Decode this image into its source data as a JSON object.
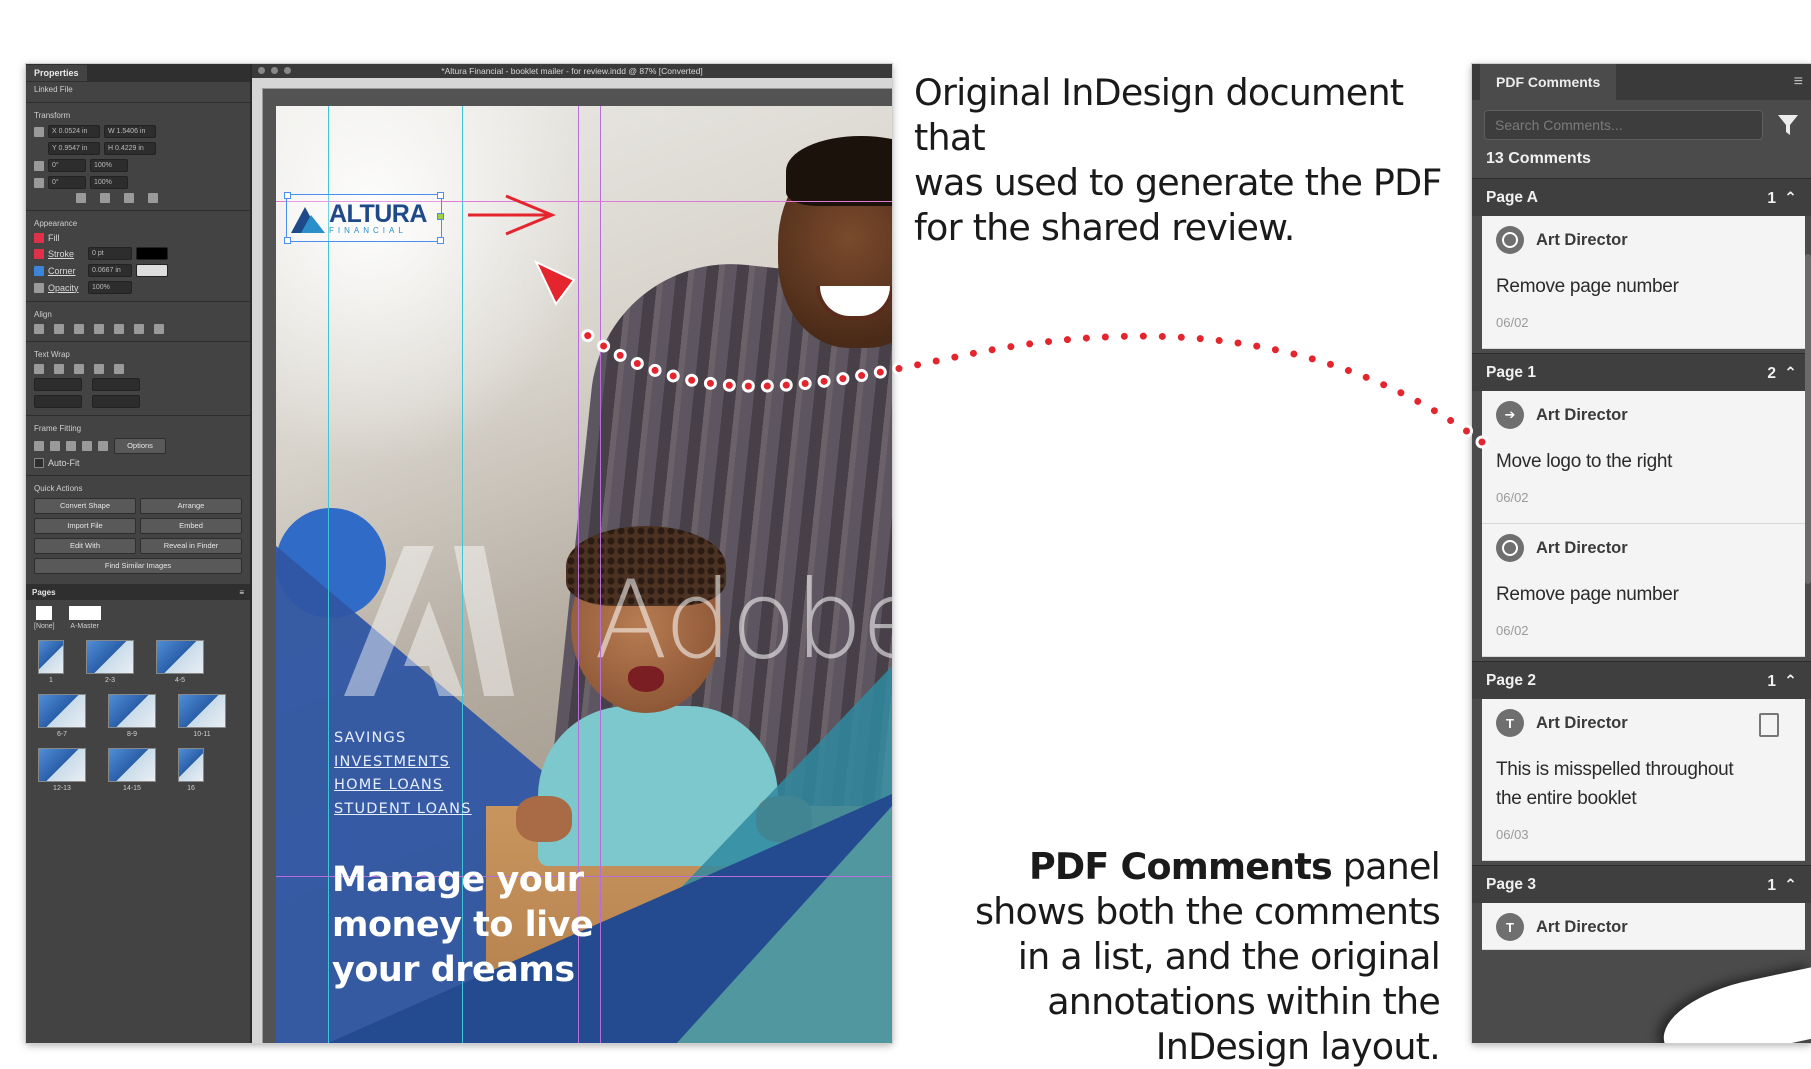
{
  "indesign": {
    "doc_title": "*Altura Financial - booklet mailer - for review.indd @ 87% [Converted]",
    "properties_tab": "Properties",
    "sections": {
      "linked_file": "Linked File",
      "transform": "Transform",
      "appearance": "Appearance",
      "align": "Align",
      "text_wrap": "Text Wrap",
      "frame_fitting": "Frame Fitting",
      "quick_actions": "Quick Actions"
    },
    "transform_fields": [
      "X  0.0524 in",
      "W  1.5406 in",
      "Y  0.9547 in",
      "H  0.4229 in",
      "0°",
      "100%",
      "0°",
      "100%"
    ],
    "appearance": {
      "fill": "Fill",
      "stroke": "Stroke",
      "stroke_weight": "0 pt",
      "corner": "Corner",
      "corner_value": "0.0667 in",
      "opacity": "Opacity",
      "opacity_value": "100%"
    },
    "auto_fit": "Auto-Fit",
    "frame_fit_options": "Options",
    "quick_action_buttons": [
      "Convert Shape",
      "Arrange",
      "Import File",
      "Embed",
      "Edit With",
      "Reveal in Finder"
    ],
    "find_similar": "Find Similar Images",
    "pages_panel_title": "Pages",
    "masters": [
      "[None]",
      "A-Master"
    ],
    "page_thumbs": [
      "1",
      "2-3",
      "4-5",
      "6-7",
      "8-9",
      "10-11",
      "12-13",
      "14-15",
      "16"
    ],
    "logo": {
      "word": "ALTURA",
      "sub": "FINANCIAL"
    },
    "services": [
      "SAVINGS",
      "INVESTMENTS",
      "HOME LOANS",
      "STUDENT LOANS"
    ],
    "headline": [
      "Manage your",
      "money to live",
      "your dreams"
    ],
    "watermark": "Adobe"
  },
  "annotations": {
    "top": [
      "Original InDesign document that",
      "was used to generate the PDF",
      "for the shared review."
    ],
    "bottom_bold": "PDF Comments",
    "bottom_lines": [
      " panel",
      "shows both the comments",
      "in a list, and the original",
      "annotations within the",
      "InDesign layout."
    ]
  },
  "pdf_panel": {
    "title": "PDF Comments",
    "search_placeholder": "Search Comments...",
    "count": "13 Comments",
    "groups": [
      {
        "page": "Page A",
        "count": "1",
        "comments": [
          {
            "author": "Art Director",
            "text": "Remove page number",
            "date": "06/02"
          }
        ]
      },
      {
        "page": "Page 1",
        "count": "2",
        "comments": [
          {
            "author": "Art Director",
            "text": "Move logo to the right",
            "date": "06/02"
          },
          {
            "author": "Art Director",
            "text": "Remove page number",
            "date": "06/02"
          }
        ]
      },
      {
        "page": "Page 2",
        "count": "1",
        "comments": [
          {
            "author": "Art Director",
            "text": "This is misspelled throughout the entire booklet",
            "date": "06/03"
          }
        ]
      },
      {
        "page": "Page 3",
        "count": "1",
        "comments": [
          {
            "author": "Art Director",
            "text": "",
            "date": ""
          }
        ]
      }
    ]
  },
  "colors": {
    "annotation_red": "#e4252e",
    "brand_blue": "#2f56a3",
    "panel_dark": "#4b4b4b"
  }
}
